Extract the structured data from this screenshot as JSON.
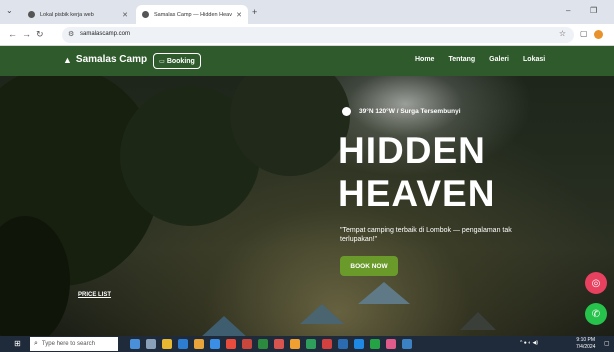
{
  "browser": {
    "tabs": [
      {
        "title": "Lokal pisbik kerja web",
        "active": false
      },
      {
        "title": "Samalas Camp — Hidden Heav",
        "active": true
      }
    ],
    "url": "samalascamp.com"
  },
  "site": {
    "brand": "Samalas Camp",
    "booking_label": "Booking",
    "nav": [
      "Home",
      "Tentang",
      "Galeri",
      "Lokasi"
    ]
  },
  "hero": {
    "coords": "39°N 120°W / Surga Tersembunyi",
    "title_line1": "HIDDEN",
    "title_line2": "HEAVEN",
    "tagline": "\"Tempat camping terbaik di Lombok — pengalaman tak terlupakan!\"",
    "cta": "BOOK NOW",
    "price_list": "PRICE LIST"
  },
  "taskbar": {
    "search_placeholder": "Type here to search",
    "time": "9:10 PM",
    "date": "7/4/2024"
  },
  "colors": {
    "nav_bg": "#2f5b2c",
    "cta_bg": "#6a9a2a",
    "instagram": "#e8405f",
    "whatsapp": "#27c24c"
  },
  "icons": [
    "tent-icon",
    "calendar-icon",
    "location-pin-icon",
    "instagram-icon",
    "whatsapp-icon",
    "search-icon",
    "windows-start-icon"
  ]
}
